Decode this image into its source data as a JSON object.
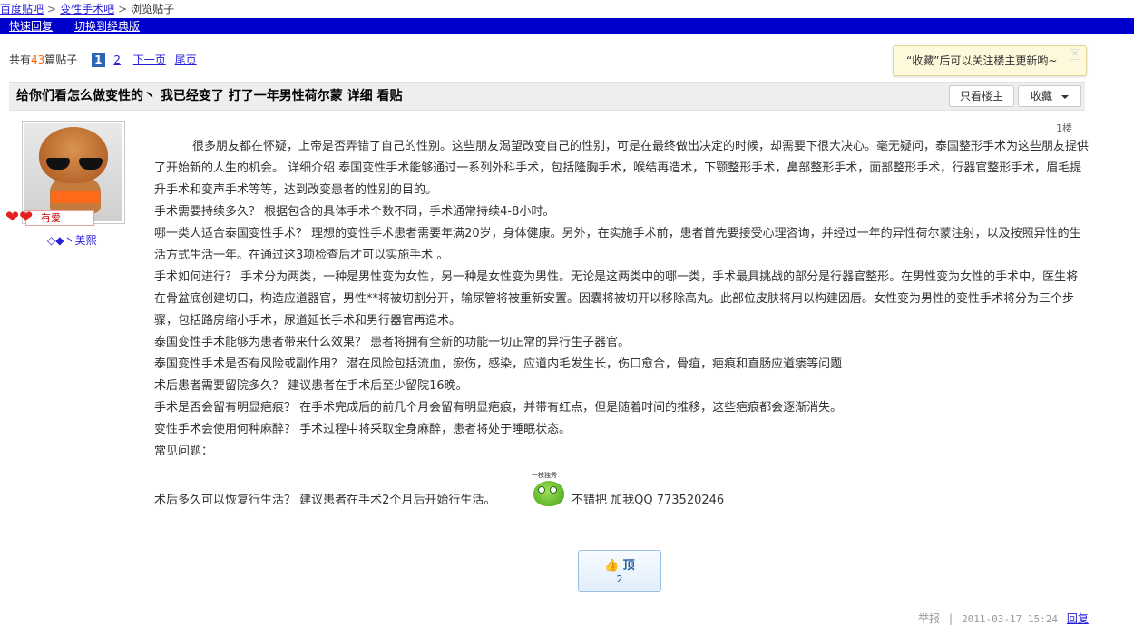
{
  "breadcrumb": {
    "home": "百度贴吧",
    "forum": "变性手术吧",
    "current": "浏览贴子",
    "sep": ">"
  },
  "toolbar": {
    "quick_reply": "快速回复",
    "switch_classic": "切换到经典版"
  },
  "pager": {
    "prefix": "共有",
    "count": "43",
    "suffix": "篇贴子",
    "current_page": "1",
    "page2": "2",
    "next": "下一页",
    "last": "尾页"
  },
  "tip": {
    "text": "“收藏”后可以关注楼主更新哟~",
    "close": "✕"
  },
  "thread": {
    "title": "给你们看怎么做变性的丶 我已经变了 打了一年男性荷尔蒙 详细 看贴",
    "only_op": "只看楼主",
    "favorite": "收藏"
  },
  "post": {
    "floor": "1楼",
    "badge": "有爱",
    "hearts": "❤❤",
    "username": "◇◆丶美熙",
    "paragraphs": [
      "很多朋友都在怀疑，上帝是否弄错了自己的性别。这些朋友渴望改变自己的性别，可是在最终做出决定的时候，却需要下很大决心。毫无疑问，泰国整形手术为这些朋友提供了开始新的人生的机会。 详细介绍 泰国变性手术能够通过一系列外科手术，包括隆胸手术，喉结再造术，下颚整形手术，鼻部整形手术，面部整形手术，行器官整形手术，眉毛提升手术和变声手术等等，达到改变患者的性别的目的。",
      "手术需要持续多久？ 根据包含的具体手术个数不同，手术通常持续4-8小时。",
      "哪一类人适合泰国变性手术？ 理想的变性手术患者需要年满20岁，身体健康。另外，在实施手术前，患者首先要接受心理咨询，并经过一年的异性荷尔蒙注射，以及按照异性的生活方式生活一年。在通过这3项检查后才可以实施手术 。",
      "手术如何进行？ 手术分为两类，一种是男性变为女性，另一种是女性变为男性。无论是这两类中的哪一类，手术最具挑战的部分是行器官整形。在男性变为女性的手术中，医生将在骨盆底创建切口，构造应道器官，男性**将被切割分开，输尿管将被重新安置。因囊将被切开以移除高丸。此部位皮肤将用以构建因唇。女性变为男性的变性手术将分为三个步骤，包括路房缩小手术，尿道延长手术和男行器官再造术。",
      "泰国变性手术能够为患者带来什么效果？ 患者将拥有全新的功能一切正常的异行生子器官。",
      "泰国变性手术是否有风险或副作用？ 潜在风险包括流血，瘀伤，感染，应道内毛发生长，伤口愈合，骨疽，疤痕和直肠应道瘘等问题",
      "术后患者需要留院多久？ 建议患者在手术后至少留院16晚。",
      "手术是否会留有明显疤痕？ 在手术完成后的前几个月会留有明显疤痕，并带有红点，但是随着时间的推移，这些疤痕都会逐渐消失。",
      "变性手术会使用何种麻醉？ 手术过程中将采取全身麻醉，患者将处于睡眠状态。",
      "常见问题："
    ],
    "last_line_a": "术后多久可以恢复行生活？ 建议患者在手术2个月后开始行生活。",
    "emoticon_caption": "一枝独秀",
    "last_line_b": "不错把 加我QQ 773520246",
    "ding_label": "顶",
    "ding_count": "2",
    "ding_icon": "👍"
  },
  "footer": {
    "report": "举报",
    "sep": "|",
    "date": "2011-03-17 15:24",
    "reply": "回复"
  }
}
